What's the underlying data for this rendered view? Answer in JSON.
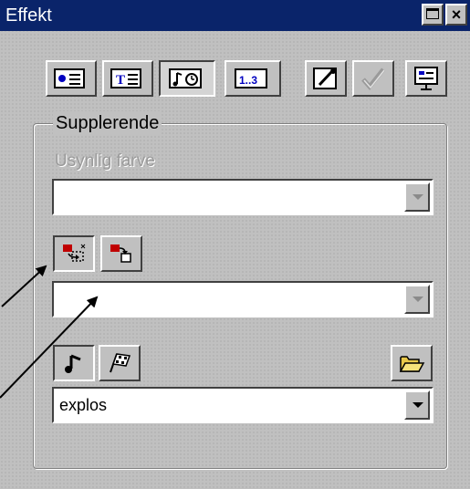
{
  "window": {
    "title": "Effekt"
  },
  "toolbar": {
    "icons": [
      "slide-icon",
      "text-icon",
      "sound-timing-icon",
      "numbering-icon",
      "edit-icon",
      "checkmark-icon",
      "presentation-icon"
    ],
    "active_index": 2
  },
  "group": {
    "label": "Supplerende",
    "invisible_color": {
      "label": "Usynlig farve",
      "value": "",
      "enabled": false
    },
    "effect_select": {
      "value": "",
      "enabled": false
    },
    "sound_select": {
      "value": "explos",
      "enabled": true
    }
  }
}
